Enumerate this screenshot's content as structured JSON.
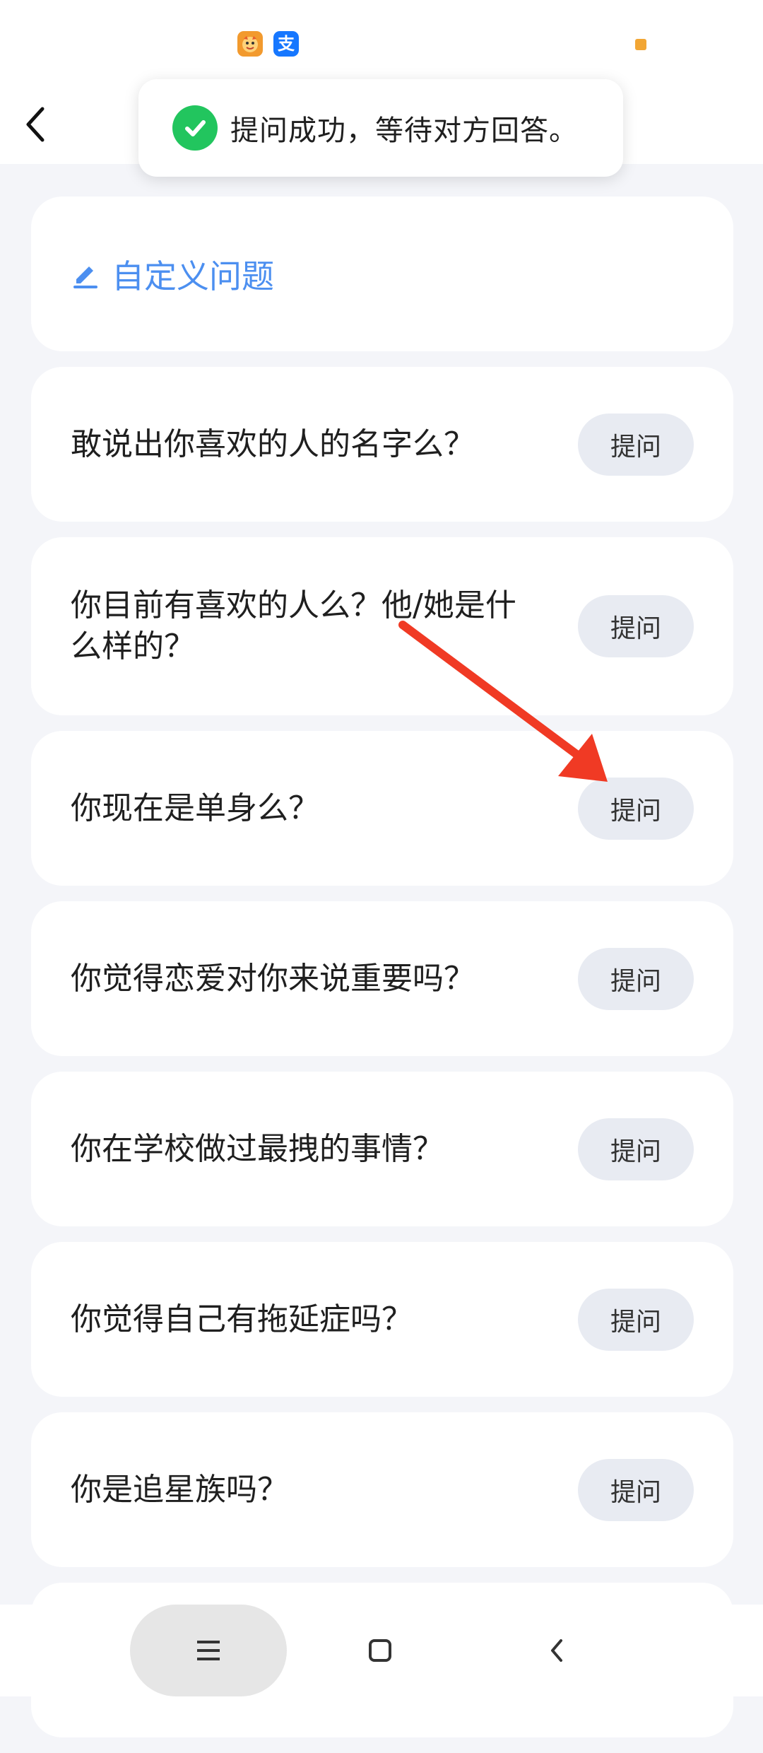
{
  "status_bar": {
    "app_icons": [
      "tiger-app-icon",
      "alipay-icon"
    ],
    "alipay_glyph": "支"
  },
  "header": {
    "back_icon": "back-chevron-icon"
  },
  "toast": {
    "text": "提问成功，等待对方回答。",
    "icon": "check-circle-icon",
    "color": "#22c55e"
  },
  "custom_question": {
    "label": "自定义问题",
    "icon": "pencil-icon",
    "color": "#4c8ff0"
  },
  "questions": [
    {
      "text": "敢说出你喜欢的人的名字么？",
      "button": "提问"
    },
    {
      "text": "你目前有喜欢的人么？他/她是什么样的？",
      "button": "提问"
    },
    {
      "text": "你现在是单身么？",
      "button": "提问"
    },
    {
      "text": "你觉得恋爱对你来说重要吗？",
      "button": "提问"
    },
    {
      "text": "你在学校做过最拽的事情？",
      "button": "提问"
    },
    {
      "text": "你觉得自己有拖延症吗？",
      "button": "提问"
    },
    {
      "text": "你是追星族吗？",
      "button": "提问"
    }
  ],
  "annotation": {
    "arrow_color": "#f03a24"
  },
  "nav_bar": {
    "icons": [
      "menu-icon",
      "home-square-icon",
      "back-icon"
    ]
  }
}
